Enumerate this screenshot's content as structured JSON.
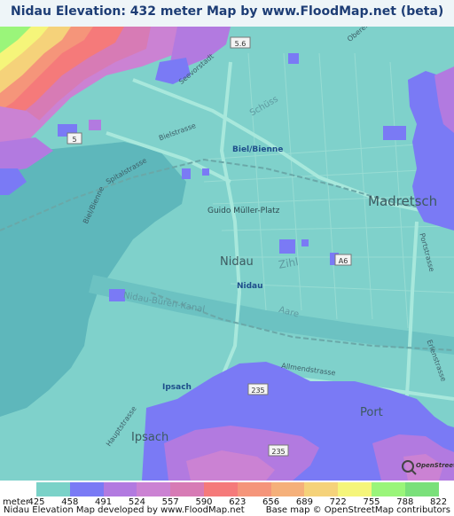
{
  "title": "Nidau Elevation: 432 meter Map by www.FloodMap.net (beta)",
  "map": {
    "place_labels": [
      {
        "text": "Nidau",
        "cls": "big"
      },
      {
        "text": "Madretsch",
        "cls": "big"
      },
      {
        "text": "Port",
        "cls": "big"
      },
      {
        "text": "Ipsach",
        "cls": "big"
      },
      {
        "text": "Biel/Bienne",
        "cls": "blue"
      },
      {
        "text": "Nidau",
        "cls": "blue"
      },
      {
        "text": "Ipsach",
        "cls": "blue"
      },
      {
        "text": "Guido Müller-Platz",
        "cls": "small"
      },
      {
        "text": "Zihl",
        "cls": "water"
      },
      {
        "text": "Nidau-Büren-Kanal",
        "cls": "water"
      },
      {
        "text": "Aare",
        "cls": "water"
      },
      {
        "text": "Schüss",
        "cls": "water"
      },
      {
        "text": "Allmendstrasse",
        "cls": "street"
      },
      {
        "text": "Portstrasse",
        "cls": "street"
      },
      {
        "text": "Erlenstrasse",
        "cls": "street"
      },
      {
        "text": "Hauptstrasse",
        "cls": "street"
      },
      {
        "text": "Spitalstrasse",
        "cls": "street"
      },
      {
        "text": "Seevorstadt",
        "cls": "street"
      },
      {
        "text": "Bielstrasse",
        "cls": "street"
      },
      {
        "text": "Oberer",
        "cls": "street"
      },
      {
        "text": "Biel/Bienne",
        "cls": "street"
      }
    ],
    "road_shields": [
      "5.6",
      "5",
      "A6",
      "235",
      "235"
    ],
    "osm_badge": "OpenStreetMap"
  },
  "legend": {
    "unit": "meter",
    "ticks": [
      "425",
      "458",
      "491",
      "524",
      "557",
      "590",
      "623",
      "656",
      "689",
      "722",
      "755",
      "788",
      "822"
    ],
    "colors": [
      "#7ad2c8",
      "#7a7af5",
      "#b27ae0",
      "#cb82d3",
      "#d77bb5",
      "#f57a7a",
      "#f5957a",
      "#f5b07a",
      "#f5d27a",
      "#f5f57a",
      "#9af57a",
      "#7ae07a"
    ],
    "footer_left": "Nidau Elevation Map developed by www.FloodMap.net",
    "footer_right": "Base map © OpenStreetMap contributors"
  }
}
